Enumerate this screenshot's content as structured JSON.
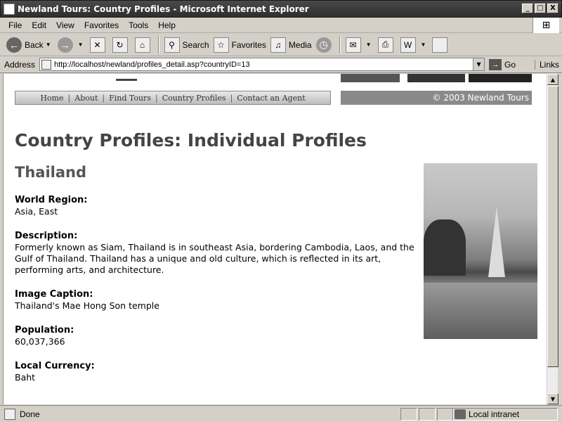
{
  "window": {
    "title": "Newland Tours: Country Profiles - Microsoft Internet Explorer",
    "minimize": "_",
    "maximize": "□",
    "close": "X"
  },
  "menu": [
    "File",
    "Edit",
    "View",
    "Favorites",
    "Tools",
    "Help"
  ],
  "toolbar": {
    "back": "Back",
    "search": "Search",
    "favorites": "Favorites",
    "media": "Media"
  },
  "address": {
    "label": "Address",
    "url": "http://localhost/newland/profiles_detail.asp?countryID=13",
    "go": "Go",
    "links": "Links"
  },
  "site": {
    "nav": [
      "Home",
      "About",
      "Find Tours",
      "Country Profiles",
      "Contact an Agent"
    ],
    "separator": "|",
    "copyright": "© 2003 Newland Tours"
  },
  "page": {
    "title": "Country Profiles: Individual Profiles",
    "country": "Thailand",
    "fields": [
      {
        "label": "World Region:",
        "value": "Asia, East"
      },
      {
        "label": "Description:",
        "value": "Formerly known as Siam, Thailand is in southeast Asia, bordering Cambodia, Laos, and the Gulf of Thailand. Thailand has a unique and old culture, which is reflected in its art, performing arts, and architecture."
      },
      {
        "label": "Image Caption:",
        "value": "Thailand's Mae Hong Son temple"
      },
      {
        "label": "Population:",
        "value": "60,037,366"
      },
      {
        "label": "Local Currency:",
        "value": "Baht"
      }
    ]
  },
  "status": {
    "text": "Done",
    "zone": "Local intranet"
  }
}
